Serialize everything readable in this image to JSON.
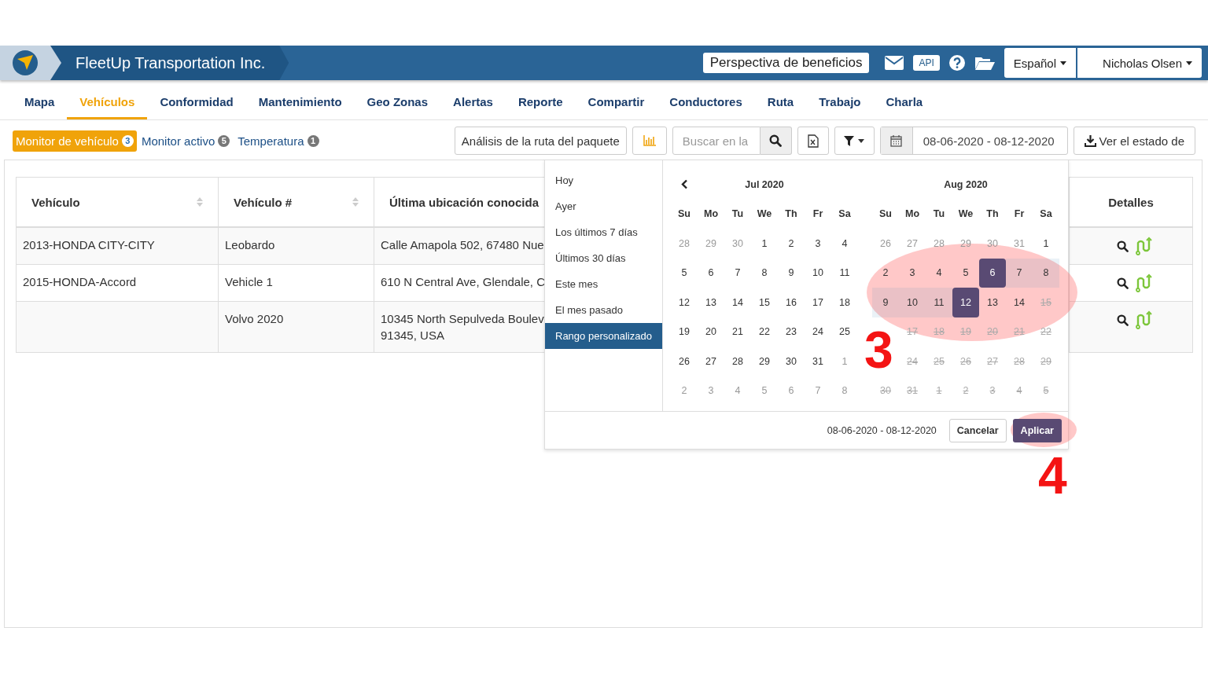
{
  "header": {
    "company": "FleetUp Transportation Inc.",
    "benefits_button": "Perspectiva de beneficios",
    "api_badge": "API",
    "language": "Español",
    "user": "Nicholas Olsen"
  },
  "nav_tabs": [
    {
      "label": "Mapa",
      "selected": false
    },
    {
      "label": "Vehículos",
      "selected": true
    },
    {
      "label": "Conformidad",
      "selected": false
    },
    {
      "label": "Mantenimiento",
      "selected": false
    },
    {
      "label": "Geo Zonas",
      "selected": false
    },
    {
      "label": "Alertas",
      "selected": false
    },
    {
      "label": "Reporte",
      "selected": false
    },
    {
      "label": "Compartir",
      "selected": false
    },
    {
      "label": "Conductores",
      "selected": false
    },
    {
      "label": "Ruta",
      "selected": false
    },
    {
      "label": "Trabajo",
      "selected": false
    },
    {
      "label": "Charla",
      "selected": false
    }
  ],
  "sub_tabs": [
    {
      "label": "Monitor de vehículo",
      "count": "3",
      "selected": true
    },
    {
      "label": "Monitor activo",
      "count": "5",
      "selected": false
    },
    {
      "label": "Temperatura",
      "count": "1",
      "selected": false
    }
  ],
  "toolbar": {
    "route_analysis_button": "Análisis de la ruta del paquete",
    "search": {
      "placeholder": "Buscar en la"
    },
    "date_range": "08-06-2020 - 08-12-2020",
    "status_button": "Ver el estado de"
  },
  "table": {
    "columns": [
      {
        "label": "Vehículo",
        "sortable": true
      },
      {
        "label": "Vehículo #",
        "sortable": true
      },
      {
        "label": "Última ubicación conocida",
        "sortable": false
      },
      {
        "label": "Detalles",
        "sortable": false
      }
    ],
    "rows": [
      {
        "cells": [
          "2013-HONDA CITY-CITY",
          "Leobardo",
          "Calle Amapola 502, 67480 Nue"
        ]
      },
      {
        "cells": [
          "2015-HONDA-Accord",
          "Vehicle 1",
          "610 N Central Ave, Glendale, C"
        ]
      },
      {
        "cells": [
          "",
          "Volvo 2020",
          "10345 North Sepulveda Boulev\n91345, USA"
        ]
      }
    ]
  },
  "date_picker": {
    "ranges": [
      {
        "label": "Hoy",
        "selected": false
      },
      {
        "label": "Ayer",
        "selected": false
      },
      {
        "label": "Los últimos 7 días",
        "selected": false
      },
      {
        "label": "Últimos 30 días",
        "selected": false
      },
      {
        "label": "Este mes",
        "selected": false
      },
      {
        "label": "El mes pasado",
        "selected": false
      },
      {
        "label": "Rango personalizado",
        "selected": true
      }
    ],
    "months": [
      {
        "title": "Jul 2020",
        "has_prev": true,
        "weekdays": [
          "Su",
          "Mo",
          "Tu",
          "We",
          "Th",
          "Fr",
          "Sa"
        ],
        "days": [
          {
            "text": "28",
            "kind": "off",
            "selected": false,
            "in_range": false
          },
          {
            "text": "29",
            "kind": "off",
            "selected": false,
            "in_range": false
          },
          {
            "text": "30",
            "kind": "off",
            "selected": false,
            "in_range": false
          },
          {
            "text": "1",
            "kind": "day",
            "selected": false,
            "in_range": false
          },
          {
            "text": "2",
            "kind": "day",
            "selected": false,
            "in_range": false
          },
          {
            "text": "3",
            "kind": "day",
            "selected": false,
            "in_range": false
          },
          {
            "text": "4",
            "kind": "day",
            "selected": false,
            "in_range": false
          },
          {
            "text": "5",
            "kind": "day",
            "selected": false,
            "in_range": false
          },
          {
            "text": "6",
            "kind": "day",
            "selected": false,
            "in_range": false
          },
          {
            "text": "7",
            "kind": "day",
            "selected": false,
            "in_range": false
          },
          {
            "text": "8",
            "kind": "day",
            "selected": false,
            "in_range": false
          },
          {
            "text": "9",
            "kind": "day",
            "selected": false,
            "in_range": false
          },
          {
            "text": "10",
            "kind": "day",
            "selected": false,
            "in_range": false
          },
          {
            "text": "11",
            "kind": "day",
            "selected": false,
            "in_range": false
          },
          {
            "text": "12",
            "kind": "day",
            "selected": false,
            "in_range": false
          },
          {
            "text": "13",
            "kind": "day",
            "selected": false,
            "in_range": false
          },
          {
            "text": "14",
            "kind": "day",
            "selected": false,
            "in_range": false
          },
          {
            "text": "15",
            "kind": "day",
            "selected": false,
            "in_range": false
          },
          {
            "text": "16",
            "kind": "day",
            "selected": false,
            "in_range": false
          },
          {
            "text": "17",
            "kind": "day",
            "selected": false,
            "in_range": false
          },
          {
            "text": "18",
            "kind": "day",
            "selected": false,
            "in_range": false
          },
          {
            "text": "19",
            "kind": "day",
            "selected": false,
            "in_range": false
          },
          {
            "text": "20",
            "kind": "day",
            "selected": false,
            "in_range": false
          },
          {
            "text": "21",
            "kind": "day",
            "selected": false,
            "in_range": false
          },
          {
            "text": "22",
            "kind": "day",
            "selected": false,
            "in_range": false
          },
          {
            "text": "23",
            "kind": "day",
            "selected": false,
            "in_range": false
          },
          {
            "text": "24",
            "kind": "day",
            "selected": false,
            "in_range": false
          },
          {
            "text": "25",
            "kind": "day",
            "selected": false,
            "in_range": false
          },
          {
            "text": "26",
            "kind": "day",
            "selected": false,
            "in_range": false
          },
          {
            "text": "27",
            "kind": "day",
            "selected": false,
            "in_range": false
          },
          {
            "text": "28",
            "kind": "day",
            "selected": false,
            "in_range": false
          },
          {
            "text": "29",
            "kind": "day",
            "selected": false,
            "in_range": false
          },
          {
            "text": "30",
            "kind": "day",
            "selected": false,
            "in_range": false
          },
          {
            "text": "31",
            "kind": "day",
            "selected": false,
            "in_range": false
          },
          {
            "text": "1",
            "kind": "off",
            "selected": false,
            "in_range": false
          },
          {
            "text": "2",
            "kind": "off",
            "selected": false,
            "in_range": false
          },
          {
            "text": "3",
            "kind": "off",
            "selected": false,
            "in_range": false
          },
          {
            "text": "4",
            "kind": "off",
            "selected": false,
            "in_range": false
          },
          {
            "text": "5",
            "kind": "off",
            "selected": false,
            "in_range": false
          },
          {
            "text": "6",
            "kind": "off",
            "selected": false,
            "in_range": false
          },
          {
            "text": "7",
            "kind": "off",
            "selected": false,
            "in_range": false
          },
          {
            "text": "8",
            "kind": "off",
            "selected": false,
            "in_range": false
          }
        ]
      },
      {
        "title": "Aug 2020",
        "has_prev": false,
        "weekdays": [
          "Su",
          "Mo",
          "Tu",
          "We",
          "Th",
          "Fr",
          "Sa"
        ],
        "days": [
          {
            "text": "26",
            "kind": "off",
            "selected": false,
            "in_range": false
          },
          {
            "text": "27",
            "kind": "off",
            "selected": false,
            "in_range": false
          },
          {
            "text": "28",
            "kind": "off",
            "selected": false,
            "in_range": false
          },
          {
            "text": "29",
            "kind": "off",
            "selected": false,
            "in_range": false
          },
          {
            "text": "30",
            "kind": "off",
            "selected": false,
            "in_range": false
          },
          {
            "text": "31",
            "kind": "off",
            "selected": false,
            "in_range": false
          },
          {
            "text": "1",
            "kind": "day",
            "selected": false,
            "in_range": false
          },
          {
            "text": "2",
            "kind": "day",
            "selected": false,
            "in_range": false
          },
          {
            "text": "3",
            "kind": "day",
            "selected": false,
            "in_range": false
          },
          {
            "text": "4",
            "kind": "day",
            "selected": false,
            "in_range": false
          },
          {
            "text": "5",
            "kind": "day",
            "selected": false,
            "in_range": false
          },
          {
            "text": "6",
            "kind": "day",
            "selected": true,
            "in_range": false
          },
          {
            "text": "7",
            "kind": "day",
            "selected": false,
            "in_range": true
          },
          {
            "text": "8",
            "kind": "day",
            "selected": false,
            "in_range": true
          },
          {
            "text": "9",
            "kind": "day",
            "selected": false,
            "in_range": true
          },
          {
            "text": "10",
            "kind": "day",
            "selected": false,
            "in_range": true
          },
          {
            "text": "11",
            "kind": "day",
            "selected": false,
            "in_range": true
          },
          {
            "text": "12",
            "kind": "day",
            "selected": true,
            "in_range": false
          },
          {
            "text": "13",
            "kind": "day",
            "selected": false,
            "in_range": false
          },
          {
            "text": "14",
            "kind": "day",
            "selected": false,
            "in_range": false
          },
          {
            "text": "15",
            "kind": "disabled",
            "selected": false,
            "in_range": false
          },
          {
            "kind": "covered"
          },
          {
            "text": "17",
            "kind": "disabled",
            "selected": false,
            "in_range": false
          },
          {
            "text": "18",
            "kind": "disabled",
            "selected": false,
            "in_range": false
          },
          {
            "text": "19",
            "kind": "disabled",
            "selected": false,
            "in_range": false
          },
          {
            "text": "20",
            "kind": "disabled",
            "selected": false,
            "in_range": false
          },
          {
            "text": "21",
            "kind": "disabled",
            "selected": false,
            "in_range": false
          },
          {
            "text": "22",
            "kind": "disabled",
            "selected": false,
            "in_range": false
          },
          {
            "kind": "covered"
          },
          {
            "text": "24",
            "kind": "disabled",
            "selected": false,
            "in_range": false
          },
          {
            "text": "25",
            "kind": "disabled",
            "selected": false,
            "in_range": false
          },
          {
            "text": "26",
            "kind": "disabled",
            "selected": false,
            "in_range": false
          },
          {
            "text": "27",
            "kind": "disabled",
            "selected": false,
            "in_range": false
          },
          {
            "text": "28",
            "kind": "disabled",
            "selected": false,
            "in_range": false
          },
          {
            "text": "29",
            "kind": "disabled",
            "selected": false,
            "in_range": false
          },
          {
            "text": "30",
            "kind": "disabled",
            "selected": false,
            "in_range": false
          },
          {
            "text": "31",
            "kind": "disabled",
            "selected": false,
            "in_range": false
          },
          {
            "text": "1",
            "kind": "disabled",
            "selected": false,
            "in_range": false
          },
          {
            "text": "2",
            "kind": "disabled",
            "selected": false,
            "in_range": false
          },
          {
            "text": "3",
            "kind": "disabled",
            "selected": false,
            "in_range": false
          },
          {
            "text": "4",
            "kind": "disabled",
            "selected": false,
            "in_range": false
          },
          {
            "text": "5",
            "kind": "disabled",
            "selected": false,
            "in_range": false
          }
        ]
      }
    ],
    "range_text": "08-06-2020 - 08-12-2020",
    "cancel_button": "Cancelar",
    "apply_button": "Aplicar"
  },
  "annotations": [
    {
      "text": "3"
    },
    {
      "text": "4"
    }
  ]
}
